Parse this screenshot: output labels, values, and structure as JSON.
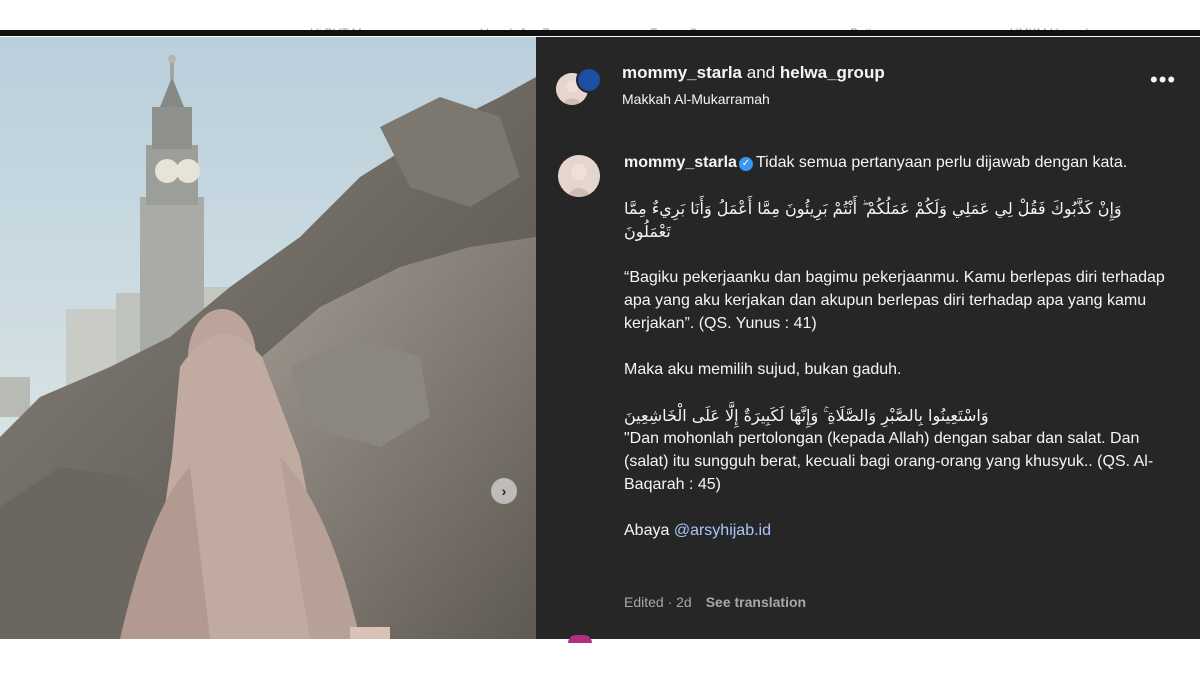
{
  "browser_tabs": [
    "Hi PUT Mara",
    "Umrah Jan Z...",
    "Teman Seara...",
    "Dating",
    "UMKM Ummah"
  ],
  "photo": {
    "carousel_next_glyph": "›"
  },
  "header": {
    "user": "mommy_starla",
    "joiner": "and",
    "collaborator": "helwa_group",
    "location": "Makkah Al-Mukarramah",
    "more_glyph": "•••"
  },
  "caption": {
    "username": "mommy_starla",
    "line1": "Tidak semua pertanyaan perlu dijawab dengan kata.",
    "arabic1": "وَإِنْ كَذَّبُوكَ فَقُلْ لِي عَمَلِي وَلَكُمْ عَمَلُكُمْ ۖ أَنْتُمْ بَرِيئُونَ مِمَّا أَعْمَلُ وَأَنَا بَرِيءٌ مِمَّا تَعْمَلُونَ",
    "translation1": "“Bagiku pekerjaanku dan bagimu pekerjaanmu. Kamu berlepas diri terhadap apa yang aku kerjakan dan akupun berlepas diri terhadap apa yang kamu kerjakan”. (QS. Yunus : 41)",
    "line2": "Maka aku memilih sujud, bukan gaduh.",
    "arabic2": "وَاسْتَعِينُوا بِالصَّبْرِ وَالصَّلَاةِ ۚ وَإِنَّهَا لَكَبِيرَةٌ إِلَّا عَلَى الْخَاشِعِينَ",
    "translation2": "\"Dan mohonlah pertolongan (kepada Allah) dengan sabar dan salat. Dan (salat) itu sungguh berat, kecuali bagi orang-orang yang khusyuk.. (QS. Al-Baqarah : 45)",
    "abaya_label": "Abaya",
    "abaya_mention": "@arsyhijab.id"
  },
  "meta": {
    "edited": "Edited · 2d",
    "see_translation": "See translation"
  },
  "colors": {
    "panel_bg": "#262626",
    "verified": "#3897f0",
    "mention": "#a8c7fa"
  }
}
